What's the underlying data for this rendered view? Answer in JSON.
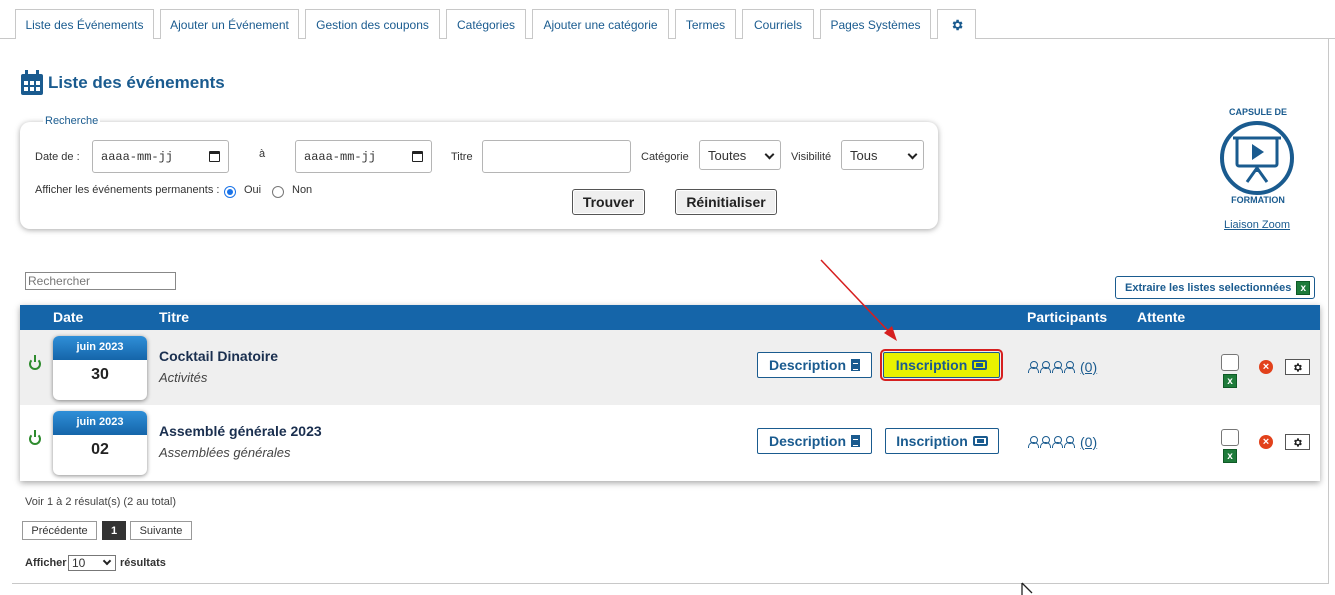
{
  "tabs": [
    {
      "label": "Liste des Événements"
    },
    {
      "label": "Ajouter un Événement"
    },
    {
      "label": "Gestion des coupons"
    },
    {
      "label": "Catégories"
    },
    {
      "label": "Ajouter une catégorie"
    },
    {
      "label": "Termes"
    },
    {
      "label": "Courriels"
    },
    {
      "label": "Pages Systèmes"
    },
    {
      "icon": "gear-icon"
    }
  ],
  "page": {
    "title": "Liste des événements",
    "icon": "calendar-icon"
  },
  "search": {
    "legend": "Recherche",
    "date_from_label": "Date de :",
    "date_from_placeholder": "aaaa-mm-jj",
    "date_to_label": "à",
    "date_to_placeholder": "aaaa-mm-jj",
    "title_label": "Titre",
    "title_value": "",
    "category_label": "Catégorie",
    "category_value": "Toutes",
    "visibility_label": "Visibilité",
    "visibility_value": "Tous",
    "permanent_label": "Afficher les événements permanents :",
    "permanent_yes": "Oui",
    "permanent_no": "Non",
    "permanent_selected": "Oui",
    "find_button": "Trouver",
    "reset_button": "Réinitialiser"
  },
  "logo": {
    "top_text": "CAPSULE DE",
    "bottom_text": "FORMATION",
    "link": "Liaison Zoom"
  },
  "list": {
    "search_placeholder": "Rechercher",
    "export_button": "Extraire les listes selectionnées",
    "headers": {
      "date": "Date",
      "title": "Titre",
      "participants": "Participants",
      "waiting": "Attente"
    },
    "rows": [
      {
        "month": "juin 2023",
        "day": "30",
        "title": "Cocktail Dinatoire",
        "category": "Activités",
        "description_button": "Description",
        "inscription_button": "Inscription",
        "participants": "(0)",
        "highlighted": true
      },
      {
        "month": "juin 2023",
        "day": "02",
        "title": "Assemblé générale 2023",
        "category": "Assemblées générales",
        "description_button": "Description",
        "inscription_button": "Inscription",
        "participants": "(0)",
        "highlighted": false
      }
    ],
    "info": "Voir 1 à 2 résulat(s) (2 au total)",
    "pagination": {
      "prev": "Précédente",
      "current": "1",
      "next": "Suivante"
    },
    "show_label": "Afficher",
    "show_value": "10",
    "show_suffix": "résultats"
  },
  "colors": {
    "accent": "#1565a9",
    "link": "#1a5b8f",
    "highlight": "#e9f200",
    "annotation": "#d61f1f"
  }
}
